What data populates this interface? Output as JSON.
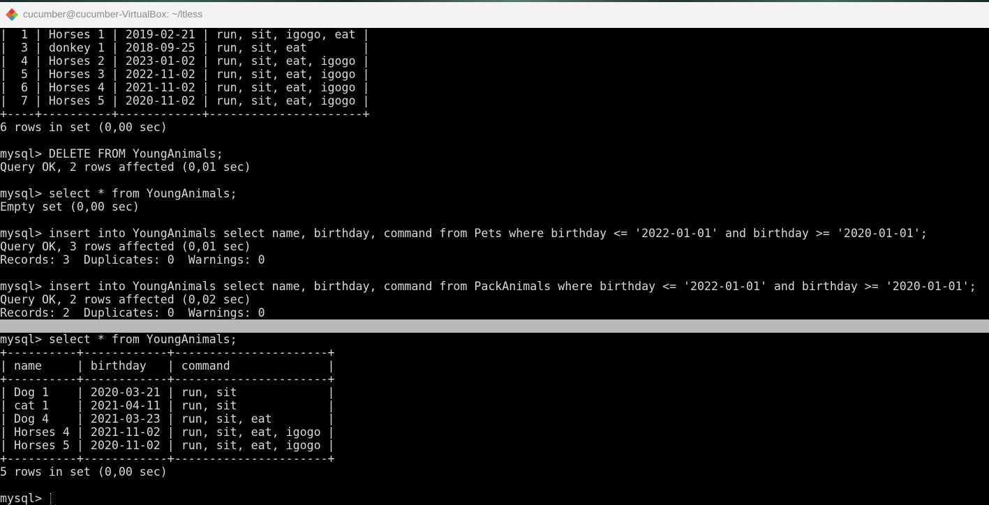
{
  "window": {
    "title": "cucumber@cucumber-VirtualBox: ~/ltless",
    "icon": "git-bash-diamond-icon",
    "accent_colors": {
      "icon_orange": "#f0642d",
      "icon_red": "#d8363a",
      "icon_teal": "#27a3a0",
      "icon_green": "#8cc63f"
    }
  },
  "terminal": {
    "lines": [
      "|  1 | Horses 1 | 2019-02-21 | run, sit, igogo, eat |",
      "|  3 | donkey 1 | 2018-09-25 | run, sit, eat        |",
      "|  4 | Horses 2 | 2023-01-02 | run, sit, eat, igogo |",
      "|  5 | Horses 3 | 2022-11-02 | run, sit, eat, igogo |",
      "|  6 | Horses 4 | 2021-11-02 | run, sit, eat, igogo |",
      "|  7 | Horses 5 | 2020-11-02 | run, sit, eat, igogo |",
      "+----+----------+------------+----------------------+",
      "6 rows in set (0,00 sec)",
      "",
      "mysql> DELETE FROM YoungAnimals;",
      "Query OK, 2 rows affected (0,01 sec)",
      "",
      "mysql> select * from YoungAnimals;",
      "Empty set (0,00 sec)",
      "",
      "mysql> insert into YoungAnimals select name, birthday, command from Pets where birthday <= '2022-01-01' and birthday >= '2020-01-01';",
      "Query OK, 3 rows affected (0,01 sec)",
      "Records: 3  Duplicates: 0  Warnings: 0",
      "",
      "mysql> insert into YoungAnimals select name, birthday, command from PackAnimals where birthday <= '2022-01-01' and birthday >= '2020-01-01';",
      "Query OK, 2 rows affected (0,02 sec)",
      "Records: 2  Duplicates: 0  Warnings: 0",
      "",
      "mysql> select * from YoungAnimals;",
      "+----------+------------+----------------------+",
      "| name     | birthday   | command              |",
      "+----------+------------+----------------------+",
      "| Dog 1    | 2020-03-21 | run, sit             |",
      "| cat 1    | 2021-04-11 | run, sit             |",
      "| Dog 4    | 2021-03-23 | run, sit, eat        |",
      "| Horses 4 | 2021-11-02 | run, sit, eat, igogo |",
      "| Horses 5 | 2020-11-02 | run, sit, eat, igogo |",
      "+----------+------------+----------------------+",
      "5 rows in set (0,00 sec)",
      "",
      "mysql> "
    ]
  }
}
